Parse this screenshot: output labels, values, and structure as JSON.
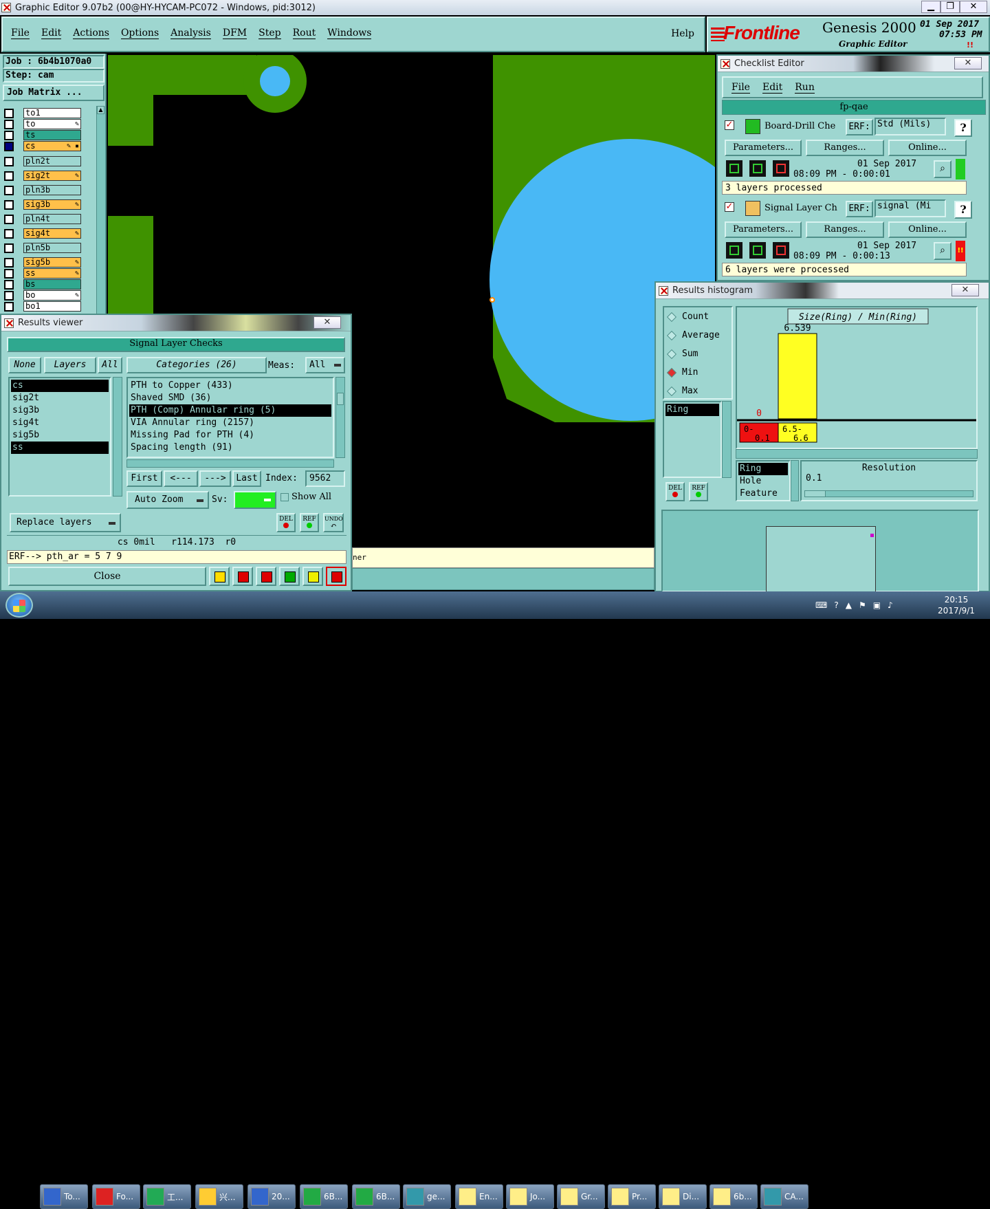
{
  "titlebar": {
    "title": "Graphic Editor 9.07b2 (00@HY-HYCAM-PC072 - Windows, pid:3012)"
  },
  "menu": {
    "items": [
      "File",
      "Edit",
      "Actions",
      "Options",
      "Analysis",
      "DFM",
      "Step",
      "Rout",
      "Windows"
    ],
    "help": "Help"
  },
  "brand": {
    "logo": "Frontline",
    "product": "Genesis 2000",
    "subtitle": "Graphic Editor",
    "date": "01 Sep 2017",
    "time": "07:53 PM",
    "alert": "!!"
  },
  "job": {
    "job_label": "Job : 6b4b1070a0",
    "step_label": "Step: cam",
    "matrix_btn": "Job Matrix ..."
  },
  "layers": [
    {
      "name": "to1",
      "color": "#ffffff",
      "sel": false,
      "mark": ""
    },
    {
      "name": "to",
      "color": "#ffffff",
      "sel": false,
      "mark": "✎"
    },
    {
      "name": "ts",
      "color": "#2fa88f",
      "sel": false,
      "mark": ""
    },
    {
      "name": "cs",
      "color": "#ffc04a",
      "sel": true,
      "mark": "✎ ▪"
    },
    {
      "name": "pln2t",
      "color": "#9ed6d0",
      "sel": false,
      "mark": ""
    },
    {
      "name": "sig2t",
      "color": "#ffc04a",
      "sel": false,
      "mark": "✎"
    },
    {
      "name": "pln3b",
      "color": "#9ed6d0",
      "sel": false,
      "mark": ""
    },
    {
      "name": "sig3b",
      "color": "#ffc04a",
      "sel": false,
      "mark": "✎"
    },
    {
      "name": "pln4t",
      "color": "#9ed6d0",
      "sel": false,
      "mark": ""
    },
    {
      "name": "sig4t",
      "color": "#ffc04a",
      "sel": false,
      "mark": "✎"
    },
    {
      "name": "pln5b",
      "color": "#9ed6d0",
      "sel": false,
      "mark": ""
    },
    {
      "name": "sig5b",
      "color": "#ffc04a",
      "sel": false,
      "mark": "✎"
    },
    {
      "name": "ss",
      "color": "#ffc04a",
      "sel": false,
      "mark": "✎"
    },
    {
      "name": "bs",
      "color": "#2fa88f",
      "sel": false,
      "mark": ""
    },
    {
      "name": "bo",
      "color": "#ffffff",
      "sel": false,
      "mark": "✎"
    },
    {
      "name": "bo1",
      "color": "#ffffff",
      "sel": false,
      "mark": ""
    }
  ],
  "results_viewer": {
    "title": "Results viewer",
    "close_x": "✕",
    "header": "Signal Layer Checks",
    "none_btn": "None",
    "layers_btn": "Layers",
    "all_btn": "All",
    "categories_btn": "Categories (26)",
    "meas_label": "Meas:",
    "meas_value": "All",
    "layer_list": [
      "cs",
      "sig2t",
      "sig3b",
      "sig4t",
      "sig5b",
      "ss"
    ],
    "selected_layers": [
      "cs",
      "ss"
    ],
    "categories": [
      "PTH to Copper (433)",
      "Shaved SMD (36)",
      "PTH (Comp) Annular ring (5)",
      "VIA Annular ring (2157)",
      "Missing Pad for PTH (4)",
      "Spacing length (91)"
    ],
    "selected_category": "PTH (Comp) Annular ring (5)",
    "first": "First",
    "prev": "<---",
    "next": "--->",
    "last": "Last",
    "index_label": "Index:",
    "index_value": "9562",
    "auto_zoom": "Auto Zoom",
    "sv_label": "Sv:",
    "show_all": "Show All",
    "replace_layers": "Replace layers",
    "del": "DEL",
    "ref": "REF",
    "undo": "UNDO",
    "status": "cs 0mil   r114.173  r0",
    "erf": "ERF--> pth_ar = 5 7 9",
    "close": "Close"
  },
  "bottom_status": {
    "text": "ner"
  },
  "checklist": {
    "title": "Checklist Editor",
    "menu": [
      "File",
      "Edit",
      "Run"
    ],
    "name": "fp-qae",
    "checks": [
      {
        "name": "Board-Drill Che",
        "erf_label": "ERF:",
        "erf_value": "Std (Mils)",
        "help": "?",
        "params": "Parameters...",
        "ranges": "Ranges...",
        "online": "Online...",
        "date": "01 Sep 2017",
        "time": "08:09 PM - 0:00:01",
        "status": "3 layers processed",
        "indicator": "#22cc22",
        "indicator_text": ""
      },
      {
        "name": "Signal Layer Ch",
        "erf_label": "ERF:",
        "erf_value": "signal (Mi",
        "help": "?",
        "params": "Parameters...",
        "ranges": "Ranges...",
        "online": "Online...",
        "date": "01 Sep 2017",
        "time": "08:09 PM - 0:00:13",
        "status": "6 layers were processed",
        "indicator": "#ee1111",
        "indicator_text": "!!"
      }
    ]
  },
  "histogram": {
    "title": "Results histogram",
    "options": [
      "Count",
      "Average",
      "Sum",
      "Min",
      "Max"
    ],
    "selected_option": "Min",
    "chart_title": "Size(Ring) / Min(Ring)",
    "bars": [
      {
        "label": "0-0.1",
        "value": 0,
        "value_label": "0",
        "color": "#ee1111"
      },
      {
        "label": "6.5-6.6",
        "value": 6.539,
        "value_label": "6.539",
        "color": "#ffff22"
      }
    ],
    "list_top": [
      "Ring"
    ],
    "list_bottom": [
      "Ring",
      "Hole",
      "Feature"
    ],
    "resolution_label": "Resolution",
    "resolution_value": "0.1",
    "del": "DEL",
    "ref": "REF"
  },
  "taskbar": {
    "items": [
      "To...",
      "Fo...",
      "工...",
      "兴...",
      "20...",
      "6B...",
      "6B...",
      "ge...",
      "En...",
      "Jo...",
      "Gr...",
      "Pr...",
      "Di...",
      "6b...",
      "CA..."
    ],
    "time": "20:15",
    "date": "2017/9/1"
  }
}
